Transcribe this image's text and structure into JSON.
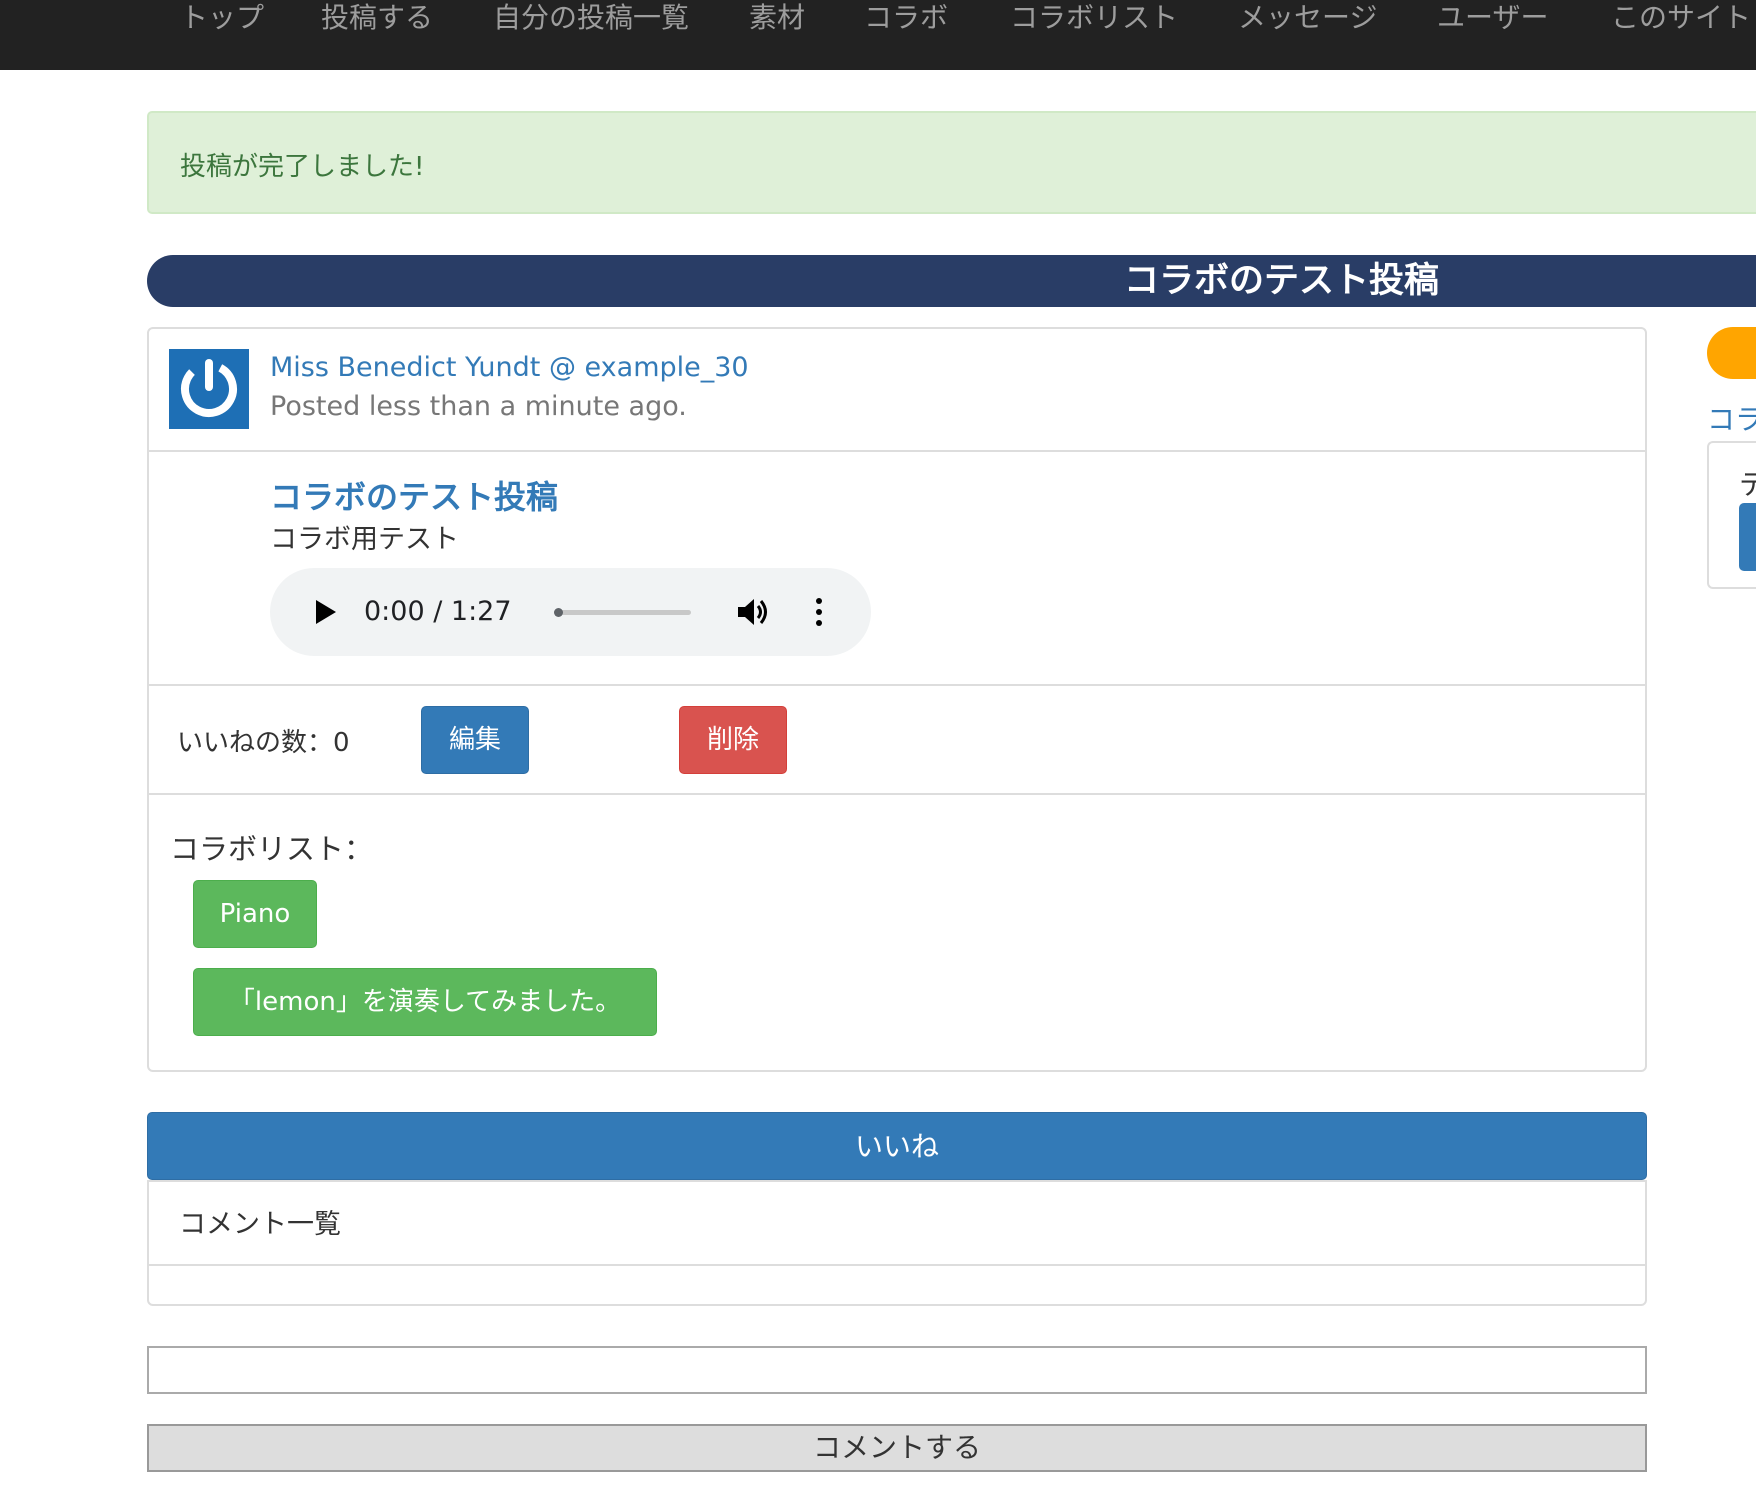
{
  "nav": {
    "items": [
      "トップ",
      "投稿する",
      "自分の投稿一覧",
      "素材",
      "コラボ",
      "コラボリスト",
      "メッセージ",
      "ユーザー",
      "このサイト"
    ]
  },
  "alert": {
    "message": "投稿が完了しました!"
  },
  "page": {
    "title": "コラボのテスト投稿"
  },
  "post": {
    "author": "Miss Benedict Yundt @ example_30",
    "posted": "Posted less than a minute ago.",
    "title": "コラボのテスト投稿",
    "description": "コラボ用テスト",
    "audio": {
      "time": "0:00 / 1:27"
    },
    "likes_label": "いいねの数：0",
    "edit_label": "編集",
    "delete_label": "削除",
    "collab_label": "コラボリスト：",
    "collab_items": [
      "Piano",
      "「lemon」を演奏してみました。"
    ]
  },
  "like_button": "いいね",
  "comments": {
    "heading": "コメント一覧",
    "input_value": "",
    "submit_label": "コメントする"
  },
  "sidebar": {
    "link": "コラ",
    "text": "テ"
  },
  "colors": {
    "navbar": "#222222",
    "alert_bg": "#dff0d8",
    "alert_text": "#3c763d",
    "title_bar": "#293d66",
    "primary": "#337ab7",
    "danger": "#d9534f",
    "success": "#5cb85c",
    "orange": "#ffa500"
  }
}
